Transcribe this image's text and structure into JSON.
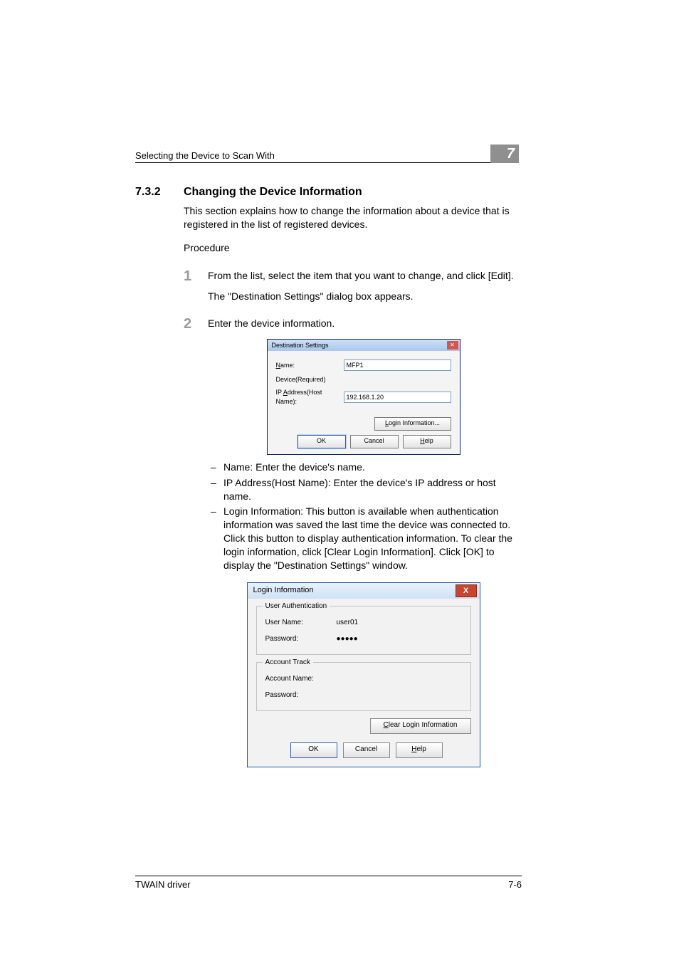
{
  "header": {
    "title": "Selecting the Device to Scan With",
    "chapter_number": "7"
  },
  "section": {
    "number": "7.3.2",
    "title": "Changing the Device Information",
    "intro": "This section explains how to change the information about a device that is registered in the list of registered devices.",
    "procedure_label": "Procedure"
  },
  "steps": {
    "s1": {
      "num": "1",
      "text": "From the list, select the item that you want to change, and click [Edit].",
      "sub": "The \"Destination Settings\" dialog box appears."
    },
    "s2": {
      "num": "2",
      "text": "Enter the device information.",
      "bullets": {
        "b1": "Name: Enter the device's name.",
        "b2": "IP Address(Host Name): Enter the device's IP address or host name.",
        "b3": "Login Information: This button is available when authentication information was saved the last time the device was connected to. Click this button to display authentication information. To clear the login information, click [Clear Login Information]. Click [OK] to display the \"Destination Settings\" window."
      }
    }
  },
  "dialog1": {
    "title": "Destination Settings",
    "name_label_pre": "N",
    "name_label_rest": "ame:",
    "name_value": "MFP1",
    "device_required": "Device(Required)",
    "ip_label_pre": "IP ",
    "ip_label_u": "A",
    "ip_label_rest": "ddress(Host Name):",
    "ip_value": "192.168.1.20",
    "login_info_u": "L",
    "login_info_rest": "ogin Information...",
    "ok": "OK",
    "cancel": "Cancel",
    "help_u": "H",
    "help_rest": "elp"
  },
  "dialog2": {
    "title": "Login Information",
    "close": "X",
    "ua_legend": "User Authentication",
    "user_name_label": "User Name:",
    "user_name_value": "user01",
    "password_label": "Password:",
    "password_value": "●●●●●",
    "at_legend": "Account Track",
    "account_name_label": "Account Name:",
    "account_name_value": "",
    "at_password_label": "Password:",
    "at_password_value": "",
    "clear_u": "C",
    "clear_rest": "lear Login Information",
    "ok": "OK",
    "cancel": "Cancel",
    "help_u": "H",
    "help_rest": "elp"
  },
  "footer": {
    "left": "TWAIN driver",
    "right": "7-6"
  }
}
